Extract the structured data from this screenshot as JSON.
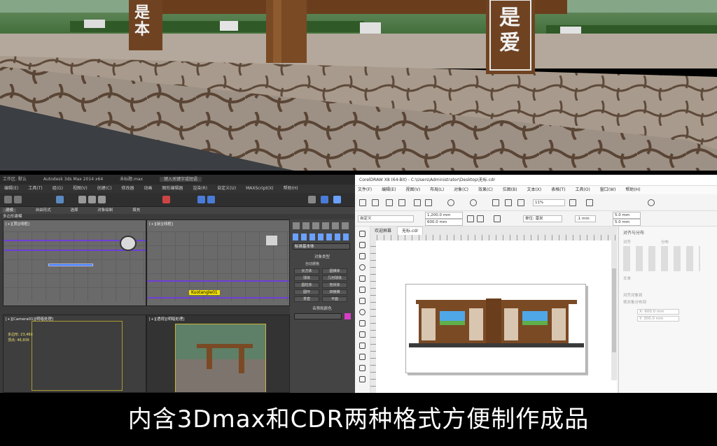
{
  "scene": {
    "sign_left_chars": [
      "是",
      "本"
    ],
    "sign_right_chars": [
      "是",
      "爱"
    ]
  },
  "max_app": {
    "title_slots": [
      "工作区: 默认",
      "Autodesk 3ds Max 2014 x64",
      "未标题.max",
      "键入关键字或短语"
    ],
    "menu_items": [
      "编辑(E)",
      "工具(T)",
      "组(G)",
      "视图(V)",
      "创建(C)",
      "修改器",
      "动画",
      "图形编辑器",
      "渲染(R)",
      "自定义(U)",
      "MAXScript(X)",
      "帮助(H)"
    ],
    "ribbon_tabs": [
      "建模",
      "自由形式",
      "选择",
      "对象绘制",
      "填充"
    ],
    "sub_label": "多边形建模",
    "viewports": {
      "top_left": "[+][顶][线框]",
      "top_right": "[+][前][线框]",
      "bottom_left": "[+][Camera01][明暗处理]",
      "bottom_right": "[+][透视][明暗处理]"
    },
    "selected_label": "Kuotangle01",
    "camera_info": [
      "多边形: 23,468",
      "顶点: 46,936"
    ],
    "command_panel": {
      "dropdown": "标准基本体",
      "section_title": "对象类型",
      "autogrid": "自动栅格",
      "buttons": [
        "长方体",
        "圆锥体",
        "球体",
        "几何球体",
        "圆柱体",
        "管状体",
        "圆环",
        "四棱锥",
        "茶壶",
        "平面"
      ],
      "name_section": "名称和颜色"
    }
  },
  "cdr_app": {
    "title": "CorelDRAW X8 (64-Bit) - C:\\Users\\Administrator\\Desktop\\无标.cdr",
    "menu_items": [
      "文件(F)",
      "编辑(E)",
      "视图(V)",
      "布局(L)",
      "对象(C)",
      "效果(C)",
      "位图(B)",
      "文本(X)",
      "表格(T)",
      "工具(O)",
      "窗口(W)",
      "帮助(H)"
    ],
    "zoom": "11%",
    "preset": "自定义",
    "width": "1,200.0 mm",
    "height": "600.0 mm",
    "units": "单位: 毫米",
    "nudge": ".1 mm",
    "dup_x": "5.0 mm",
    "dup_y": "5.0 mm",
    "tabs": [
      "欢迎屏幕",
      "无标.cdr"
    ],
    "right_panel_title": "对齐与分布",
    "right_panel_sections": [
      "对齐",
      "分布",
      "文本",
      "对齐对象到",
      "将对象分布到"
    ],
    "right_x": "X: 600.0 mm",
    "right_y": "Y: 300.0 mm"
  },
  "caption": "内含3Dmax和CDR两种格式方便制作成品",
  "colors": {
    "wood": "#7a4a25",
    "blue_highlight": "#3a4cff",
    "caption_bg": "#000000"
  }
}
